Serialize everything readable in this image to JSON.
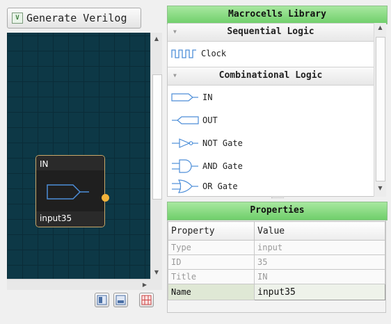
{
  "toolbar": {
    "generate_label": "Generate Verilog"
  },
  "canvas": {
    "node": {
      "title": "IN",
      "name": "input35"
    }
  },
  "library": {
    "title": "Macrocells Library",
    "categories": [
      {
        "label": "Sequential Logic",
        "items": [
          {
            "label": "Clock",
            "icon": "clock-wave-icon"
          }
        ]
      },
      {
        "label": "Combinational Logic",
        "items": [
          {
            "label": "IN",
            "icon": "input-pin-icon"
          },
          {
            "label": "OUT",
            "icon": "output-pin-icon"
          },
          {
            "label": "NOT Gate",
            "icon": "not-gate-icon"
          },
          {
            "label": "AND Gate",
            "icon": "and-gate-icon"
          },
          {
            "label": "OR Gate",
            "icon": "or-gate-icon"
          }
        ]
      }
    ]
  },
  "properties": {
    "title": "Properties",
    "col_property": "Property",
    "col_value": "Value",
    "rows": [
      {
        "key": "Type",
        "value": "input"
      },
      {
        "key": "ID",
        "value": "35"
      },
      {
        "key": "Title",
        "value": "IN"
      },
      {
        "key": "Name",
        "value": "input35"
      }
    ]
  },
  "colors": {
    "canvas_bg": "#0d3846",
    "header_green": "#6fcf6a",
    "node_border": "#c9a86a",
    "port": "#f2b23a"
  }
}
